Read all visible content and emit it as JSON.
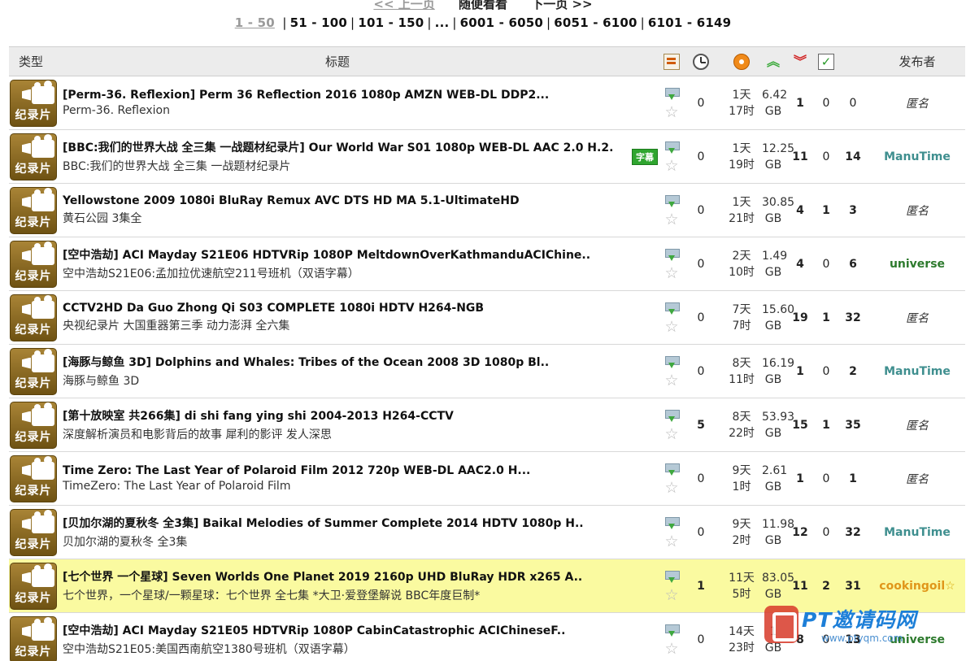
{
  "pager": {
    "prev": "<< 上一页",
    "random": "随便看看",
    "next": "下一页 >>",
    "current": "1 - 50",
    "pages": [
      "51 - 100",
      "101 - 150",
      "...",
      "6001 - 6050",
      "6051 - 6100",
      "6101 - 6149"
    ]
  },
  "headers": {
    "type": "类型",
    "title": "标题",
    "publisher": "发布者"
  },
  "icons": {
    "comments": "comments-icon",
    "time": "clock-icon",
    "size": "size-icon",
    "seeders": "seeders-up-icon",
    "leechers": "leechers-down-icon",
    "completed": "completed-check-icon",
    "download": "download-icon",
    "bookmark": "star-icon"
  },
  "category_label": "纪录片",
  "rows": [
    {
      "title": "[Perm-36. Reflexion] Perm 36 Reflection 2016 1080p AMZN WEB-DL DDP2...",
      "subtitle": "Perm-36. Reflexion",
      "badge": "",
      "comments": "0",
      "time_d": "1天",
      "time_h": "17时",
      "size_v": "6.42",
      "size_u": "GB",
      "seeders": "1",
      "leechers": "0",
      "completed": "0",
      "publisher": "匿名",
      "pub_type": "anon",
      "sticky": false
    },
    {
      "title": "[BBC:我们的世界大战 全三集 一战题材纪录片] Our World War S01 1080p WEB-DL AAC 2.0 H.2..",
      "subtitle": "BBC:我们的世界大战 全三集 一战题材纪录片",
      "badge": "字幕",
      "comments": "0",
      "time_d": "1天",
      "time_h": "19时",
      "size_v": "12.25",
      "size_u": "GB",
      "seeders": "11",
      "leechers": "0",
      "completed": "14",
      "publisher": "ManuTime",
      "pub_type": "manu",
      "sticky": false
    },
    {
      "title": "Yellowstone 2009 1080i BluRay Remux AVC DTS HD MA 5.1-UltimateHD",
      "subtitle": "黄石公园 3集全",
      "badge": "",
      "comments": "0",
      "time_d": "1天",
      "time_h": "21时",
      "size_v": "30.85",
      "size_u": "GB",
      "seeders": "4",
      "leechers": "1",
      "completed": "3",
      "publisher": "匿名",
      "pub_type": "anon",
      "sticky": false
    },
    {
      "title": "[空中浩劫] ACI Mayday S21E06 HDTVRip 1080P MeltdownOverKathmanduACIChine..",
      "subtitle": "空中浩劫S21E06:孟加拉优速航空211号班机（双语字幕）",
      "badge": "",
      "comments": "0",
      "time_d": "2天",
      "time_h": "10时",
      "size_v": "1.49",
      "size_u": "GB",
      "seeders": "4",
      "leechers": "0",
      "completed": "6",
      "publisher": "universe",
      "pub_type": "univ",
      "sticky": false
    },
    {
      "title": "CCTV2HD Da Guo Zhong Qi S03 COMPLETE 1080i HDTV H264-NGB",
      "subtitle": "央视纪录片 大国重器第三季 动力澎湃 全六集",
      "badge": "",
      "comments": "0",
      "time_d": "7天",
      "time_h": "7时",
      "size_v": "15.60",
      "size_u": "GB",
      "seeders": "19",
      "leechers": "1",
      "completed": "32",
      "publisher": "匿名",
      "pub_type": "anon",
      "sticky": false
    },
    {
      "title": "[海豚与鲸鱼 3D] Dolphins and Whales: Tribes of the Ocean 2008 3D 1080p Bl..",
      "subtitle": "海豚与鲸鱼 3D",
      "badge": "",
      "comments": "0",
      "time_d": "8天",
      "time_h": "11时",
      "size_v": "16.19",
      "size_u": "GB",
      "seeders": "1",
      "leechers": "0",
      "completed": "2",
      "publisher": "ManuTime",
      "pub_type": "manu",
      "sticky": false
    },
    {
      "title": "[第十放映室 共266集] di shi fang ying shi 2004-2013 H264-CCTV",
      "subtitle": "深度解析演员和电影背后的故事 犀利的影评 发人深思",
      "badge": "",
      "comments": "5",
      "time_d": "8天",
      "time_h": "22时",
      "size_v": "53.93",
      "size_u": "GB",
      "seeders": "15",
      "leechers": "1",
      "completed": "35",
      "publisher": "匿名",
      "pub_type": "anon",
      "sticky": false
    },
    {
      "title": "Time Zero: The Last Year of Polaroid Film 2012 720p WEB-DL AAC2.0 H...",
      "subtitle": "TimeZero: The Last Year of Polaroid Film",
      "badge": "",
      "comments": "0",
      "time_d": "9天",
      "time_h": "1时",
      "size_v": "2.61",
      "size_u": "GB",
      "seeders": "1",
      "leechers": "0",
      "completed": "1",
      "publisher": "匿名",
      "pub_type": "anon",
      "sticky": false
    },
    {
      "title": "[贝加尔湖的夏秋冬 全3集] Baikal Melodies of Summer Complete 2014 HDTV 1080p H..",
      "subtitle": "贝加尔湖的夏秋冬 全3集",
      "badge": "",
      "comments": "0",
      "time_d": "9天",
      "time_h": "2时",
      "size_v": "11.98",
      "size_u": "GB",
      "seeders": "12",
      "leechers": "0",
      "completed": "32",
      "publisher": "ManuTime",
      "pub_type": "manu",
      "sticky": false
    },
    {
      "title": "[七个世界 一个星球] Seven Worlds One Planet 2019 2160p UHD BluRay HDR x265 A..",
      "subtitle": "七个世界，一个星球/一颗星球：七个世界 全七集 *大卫·爱登堡解说 BBC年度巨制*",
      "badge": "",
      "comments": "1",
      "time_d": "11天",
      "time_h": "5时",
      "size_v": "83.05",
      "size_u": "GB",
      "seeders": "11",
      "leechers": "2",
      "completed": "31",
      "publisher": "cookingoil",
      "pub_type": "cook",
      "sticky": true
    },
    {
      "title": "[空中浩劫] ACI Mayday S21E05 HDTVRip 1080P CabinCatastrophic ACIChineseF..",
      "subtitle": "空中浩劫S21E05:美国西南航空1380号班机（双语字幕）",
      "badge": "",
      "comments": "0",
      "time_d": "14天",
      "time_h": "23时",
      "size_v": "1",
      "size_u": "GB",
      "seeders": "8",
      "leechers": "0",
      "completed": "13",
      "publisher": "universe",
      "pub_type": "univ",
      "sticky": false
    }
  ],
  "watermark": {
    "text": "PT邀请码网",
    "url": "www.ptyqm.com"
  }
}
